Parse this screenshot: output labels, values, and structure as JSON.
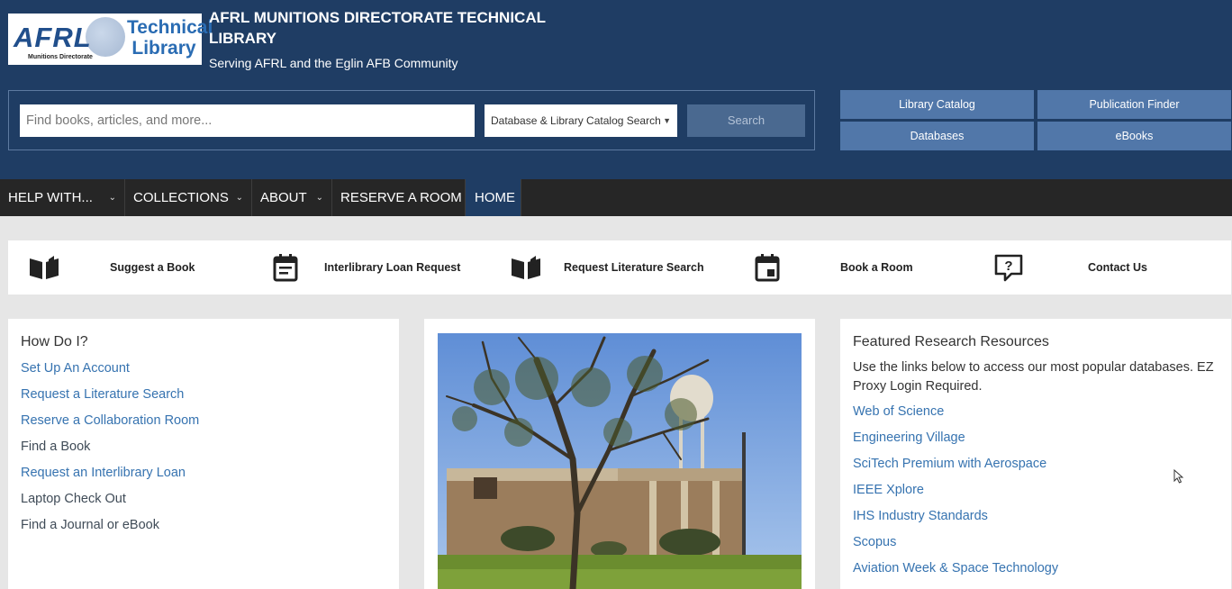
{
  "header": {
    "logo_text": "AFRL",
    "logo_library_line1": "Technical",
    "logo_library_line2": "Library",
    "logo_subtitle": "Munitions Directorate",
    "title": "AFRL MUNITIONS DIRECTORATE TECHNICAL LIBRARY",
    "subtitle": "Serving AFRL and the Eglin AFB Community"
  },
  "search": {
    "placeholder": "Find books, articles, and more...",
    "scope": "Database & Library Catalog Search",
    "button": "Search"
  },
  "quick_buttons": {
    "library_catalog": "Library Catalog",
    "publication_finder": "Publication Finder",
    "databases": "Databases",
    "ebooks": "eBooks"
  },
  "nav": {
    "help": "HELP WITH...",
    "collections": "COLLECTIONS",
    "about": "ABOUT",
    "reserve": "RESERVE A ROOM",
    "home": "HOME"
  },
  "quick_links": {
    "suggest_book": "Suggest a Book",
    "interlibrary_loan": "Interlibrary Loan Request",
    "literature_search": "Request Literature Search",
    "book_room": "Book a Room",
    "contact": "Contact Us"
  },
  "how_do_i": {
    "title": "How Do I?",
    "links": [
      "Set Up An Account",
      "Request a Literature Search",
      "Reserve a Collaboration Room",
      "Find a Book",
      "Request an Interlibrary Loan",
      "Laptop Check Out",
      "Find a Journal or eBook"
    ]
  },
  "featured": {
    "title": "Featured Research Resources",
    "intro": "Use the links below to access our most popular databases. EZ Proxy Login Required.",
    "links": [
      "Web of Science",
      "Engineering Village",
      "SciTech Premium with Aerospace",
      "IEEE Xplore",
      "IHS Industry Standards",
      "Scopus",
      "Aviation Week & Space Technology"
    ]
  },
  "colors": {
    "header_bg": "#1f3d64",
    "nav_bg": "#262626",
    "quick_button_bg": "#5177a9",
    "link": "#3673b0"
  }
}
